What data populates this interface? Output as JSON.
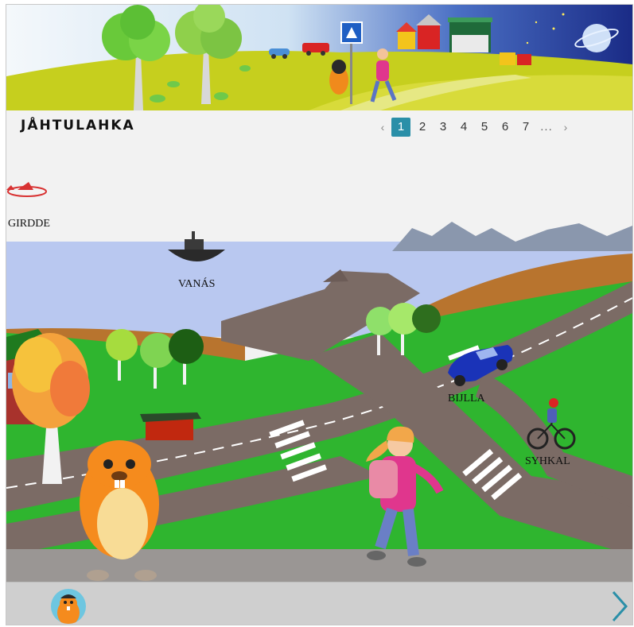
{
  "header": {
    "title": "JÅHTULAHKA"
  },
  "pagination": {
    "prev_icon": "chevron-left-icon",
    "pages": [
      "1",
      "2",
      "3",
      "4",
      "5",
      "6",
      "7"
    ],
    "active_page": "1",
    "ellipsis": "...",
    "next_icon": "chevron-right-icon"
  },
  "scene": {
    "labels": {
      "plane": "GIRDDE",
      "boat": "VANÁS",
      "car": "BIJLLA",
      "bike": "SYHKAL"
    }
  },
  "footer": {
    "avatar_icon": "beaver-avatar-icon",
    "next_icon": "chevron-right-icon"
  },
  "colors": {
    "accent": "#2a8fa8",
    "grass": "#2fb52f",
    "road": "#7b6b65",
    "water": "#b9c8f0"
  }
}
